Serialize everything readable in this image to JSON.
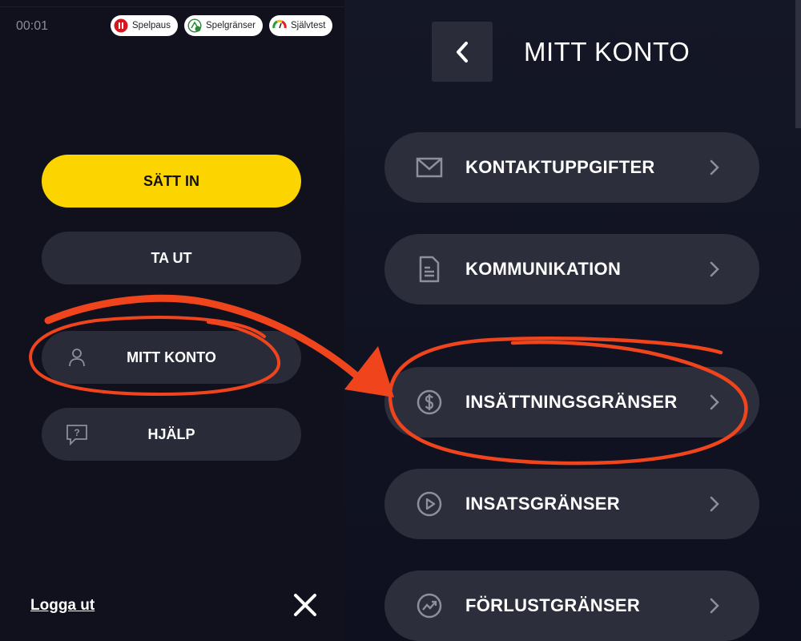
{
  "left": {
    "timer": "00:01",
    "pills": [
      {
        "label": "Spelpaus",
        "icon": "pause-icon"
      },
      {
        "label": "Spelgränser",
        "icon": "limits-icon"
      },
      {
        "label": "Självtest",
        "icon": "gauge-icon"
      }
    ],
    "deposit_label": "SÄTT IN",
    "withdraw_label": "TA UT",
    "account_label": "MITT KONTO",
    "help_label": "HJÄLP",
    "logout_label": "Logga ut"
  },
  "right": {
    "title": "MITT KONTO",
    "items": [
      {
        "label": "KONTAKTUPPGIFTER",
        "icon": "mail-icon"
      },
      {
        "label": "KOMMUNIKATION",
        "icon": "document-icon"
      },
      {
        "label": "INSÄTTNINGSGRÄNSER",
        "icon": "dollar-icon"
      },
      {
        "label": "INSATSGRÄNSER",
        "icon": "play-icon"
      },
      {
        "label": "FÖRLUSTGRÄNSER",
        "icon": "trend-icon"
      }
    ]
  },
  "colors": {
    "accent_yellow": "#fcd400",
    "highlight_red": "#f0441c",
    "button_bg": "#2c2e3c"
  }
}
